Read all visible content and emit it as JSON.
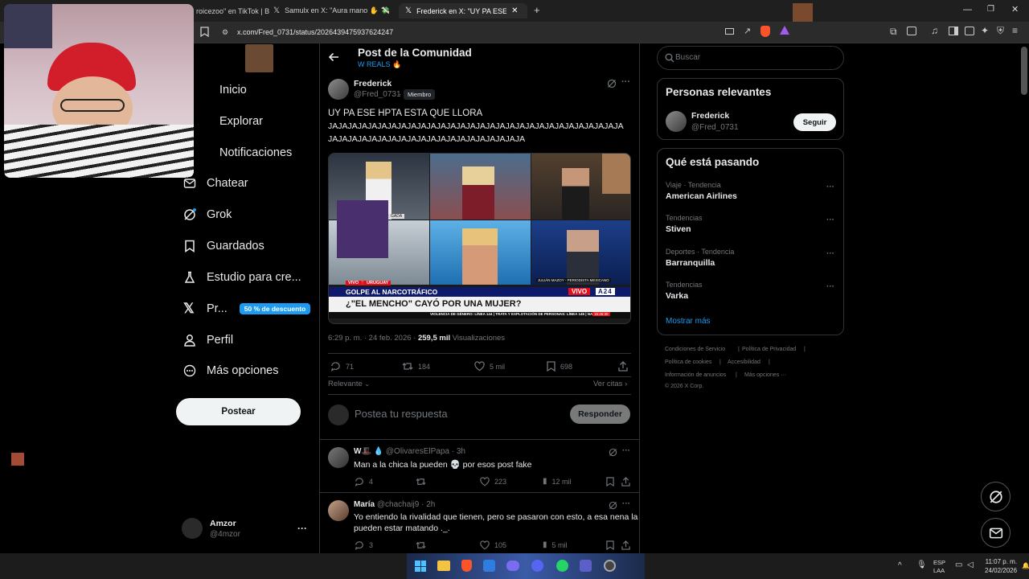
{
  "browser": {
    "tabs": [
      {
        "label": "roicezoo\" en TikTok | B"
      },
      {
        "label": "Samulx en X: \"Aura mano ✋ 💸 http"
      },
      {
        "label": "Frederick en X: \"UY PA ESE H"
      }
    ],
    "address": "x.com/Fred_0731/status/2026439475937624247"
  },
  "sidebar": {
    "nav": [
      {
        "label": "Inicio"
      },
      {
        "label": "Explorar"
      },
      {
        "label": "Notificaciones"
      },
      {
        "label": "Chatear"
      },
      {
        "label": "Grok"
      },
      {
        "label": "Guardados"
      },
      {
        "label": "Estudio para cre..."
      },
      {
        "label": "Pr..."
      },
      {
        "label": "Perfil"
      },
      {
        "label": "Más opciones"
      }
    ],
    "premium_badge": "50 % de descuento",
    "post_button": "Postear",
    "account": {
      "name": "Amzor",
      "handle": "@4mzor"
    }
  },
  "main": {
    "header_title": "Post de la Comunidad",
    "community": "W REALS 🔥",
    "post": {
      "author": "Frederick",
      "handle": "@Fred_0731",
      "member_badge": "Miembro",
      "text_line1": "UY PA ESE HPTA ESTA QUE LLORA",
      "text_line2": "JAJAJAJAJAJAJAJAJAJAJAJAJAJAJAJAJAJAJAJAJAJAJAJAJAJAJAJAJAJA",
      "text_line3": "JAJAJAJAJAJAJAJAJAJAJAJAJAJAJAJAJAJAJAJA",
      "time": "6:29 p. m. · 24 feb. 2026 ·",
      "views_count": "259,5 mil",
      "views_label": "Visualizaciones",
      "replies": "71",
      "reposts": "184",
      "likes": "5 mil",
      "bookmarks": "698"
    },
    "media": {
      "live_left": "VIVO 📍 URUGUAY",
      "strap_title": "GOLPE AL NARCOTRÁFICO",
      "headline": "¿\"EL MENCHO\" CAYÓ POR UNA MUJER?",
      "ticker": "VIOLENCIA DE GÉNERO: LÍNEA 144 | TRATA Y EXPLOTACIÓN DE PERSONAS: LÍNEA 145 | NA",
      "ticker_time": "15:45:30",
      "name_tag": "JULIÁN MAZOY - PERIODISTA MEXICANO",
      "vivo_tag": "VIVO",
      "channel_tag": "A24",
      "studio_caption": "GADA",
      "brand_colors": {
        "red": "#e3101a",
        "navy": "#0d1a6b"
      }
    },
    "sort_label": "Relevante",
    "quotes_label": "Ver citas",
    "reply_placeholder": "Postea tu respuesta",
    "reply_button": "Responder",
    "replies": [
      {
        "name": "W🎩 💧",
        "handle": "@OlivaresElPapa · 3h",
        "text": "Man a la chica la pueden 💀 por esos post fake",
        "replies": "4",
        "reposts": "",
        "likes": "223",
        "views": "12 mil"
      },
      {
        "name": "María",
        "handle": "@chachaij9 · 2h",
        "text_line1": "Yo entiendo la rivalidad que tienen, pero se pasaron con esto, a esa nena la",
        "text_line2": "pueden estar matando ._.",
        "replies": "3",
        "reposts": "",
        "likes": "105",
        "views": "5 mil"
      }
    ]
  },
  "right": {
    "search_placeholder": "Buscar",
    "relevant_title": "Personas relevantes",
    "relevant_person": {
      "name": "Frederick",
      "handle": "@Fred_0731",
      "follow": "Seguir"
    },
    "trends_title": "Qué está pasando",
    "trends": [
      {
        "meta": "Viaje · Tendencia",
        "name": "American Airlines"
      },
      {
        "meta": "Tendencias",
        "name": "Stiven"
      },
      {
        "meta": "Deportes · Tendencia",
        "name": "Barranquilla"
      },
      {
        "meta": "Tendencias",
        "name": "Varka"
      }
    ],
    "show_more": "Mostrar más",
    "footer": [
      "Condiciones de Servicio",
      "Política de Privacidad",
      "Política de cookies",
      "Accesibilidad",
      "Información de anuncios",
      "Más opciones ···",
      "© 2026 X Corp."
    ]
  },
  "taskbar": {
    "lang_line1": "ESP",
    "lang_line2": "LAA",
    "time": "11:07 p. m.",
    "date": "24/02/2026"
  }
}
